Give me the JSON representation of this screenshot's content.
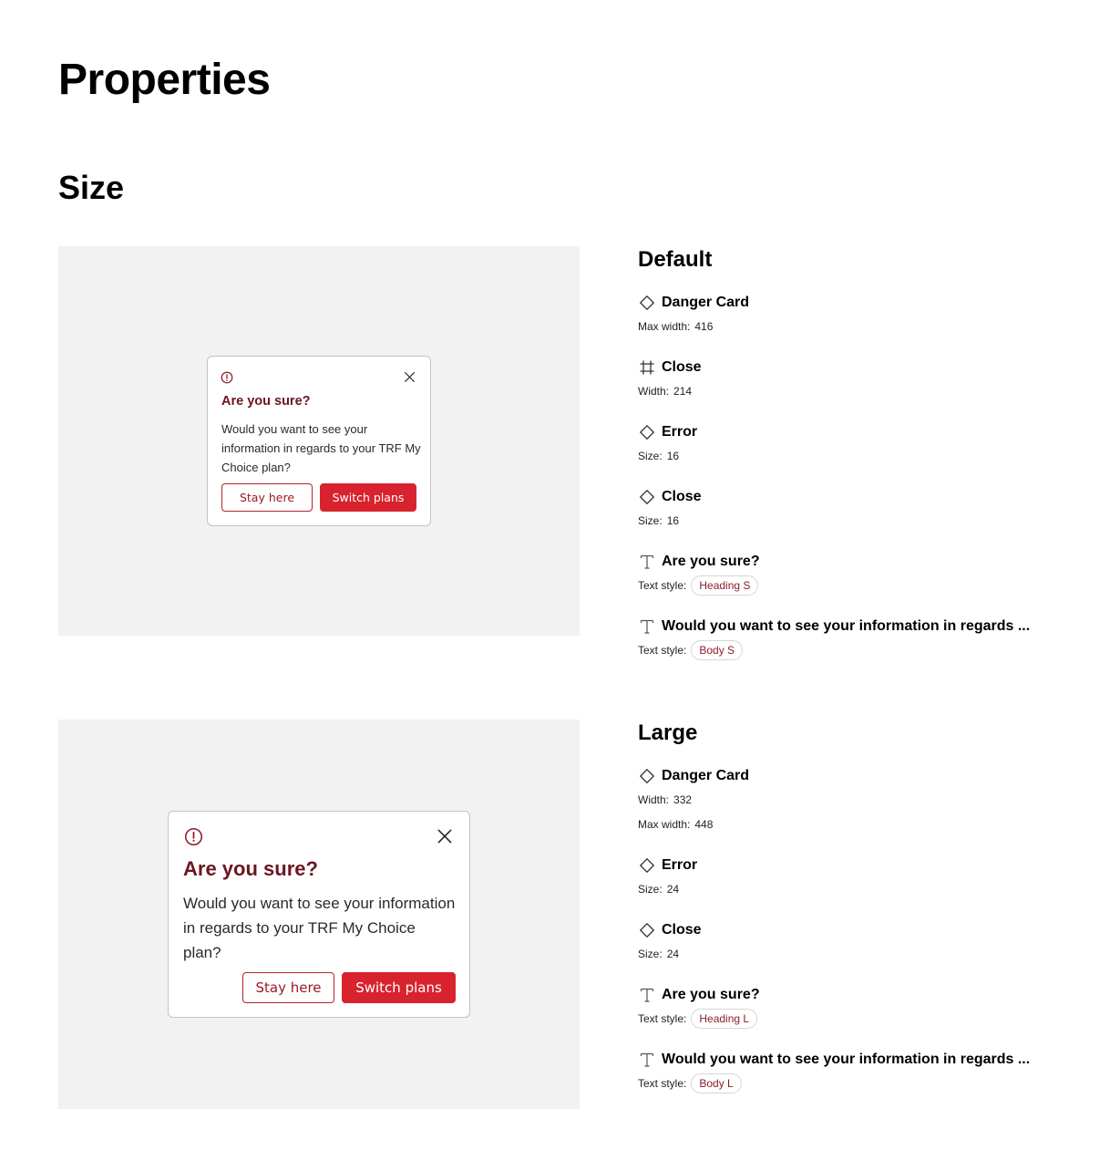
{
  "page": {
    "title": "Properties",
    "section": "Size"
  },
  "colors": {
    "danger_heading": "#6b1620",
    "danger_button": "#d8232e",
    "preview_bg": "#f2f2f2"
  },
  "default_card": {
    "heading": "Are you sure?",
    "body": "Would you want to see your information in regards to your TRF My Choice plan?",
    "secondary_label": "Stay here",
    "primary_label": "Switch plans",
    "icons": [
      "error-circle-icon",
      "close-x-icon"
    ]
  },
  "large_card": {
    "heading": "Are you sure?",
    "body": "Would you want to see your information in regards to your TRF My Choice plan?",
    "secondary_label": "Stay here",
    "primary_label": "Switch plans",
    "icons": [
      "error-circle-icon",
      "close-x-icon"
    ]
  },
  "default_props": {
    "title": "Default",
    "items": [
      {
        "icon": "component-diamond-icon",
        "name": "Danger Card",
        "rows": [
          {
            "key": "Max width:",
            "value": "416"
          }
        ]
      },
      {
        "icon": "frame-hash-icon",
        "name": "Close",
        "rows": [
          {
            "key": "Width:",
            "value": "214"
          }
        ]
      },
      {
        "icon": "component-diamond-icon",
        "name": "Error",
        "rows": [
          {
            "key": "Size:",
            "value": "16"
          }
        ]
      },
      {
        "icon": "component-diamond-icon",
        "name": "Close",
        "rows": [
          {
            "key": "Size:",
            "value": "16"
          }
        ]
      },
      {
        "icon": "text-t-icon",
        "name": "Are you sure?",
        "rows": [
          {
            "key": "Text style:",
            "pill": "Heading S"
          }
        ]
      },
      {
        "icon": "text-t-icon",
        "name": "Would you want to see your information in regards ...",
        "rows": [
          {
            "key": "Text style:",
            "pill": "Body S"
          }
        ]
      }
    ]
  },
  "large_props": {
    "title": "Large",
    "items": [
      {
        "icon": "component-diamond-icon",
        "name": "Danger Card",
        "rows": [
          {
            "key": "Width:",
            "value": "332"
          },
          {
            "key": "Max width:",
            "value": "448"
          }
        ]
      },
      {
        "icon": "component-diamond-icon",
        "name": "Error",
        "rows": [
          {
            "key": "Size:",
            "value": "24"
          }
        ]
      },
      {
        "icon": "component-diamond-icon",
        "name": "Close",
        "rows": [
          {
            "key": "Size:",
            "value": "24"
          }
        ]
      },
      {
        "icon": "text-t-icon",
        "name": "Are you sure?",
        "rows": [
          {
            "key": "Text style:",
            "pill": "Heading L"
          }
        ]
      },
      {
        "icon": "text-t-icon",
        "name": "Would you want to see your information in regards ...",
        "rows": [
          {
            "key": "Text style:",
            "pill": "Body L"
          }
        ]
      }
    ]
  }
}
